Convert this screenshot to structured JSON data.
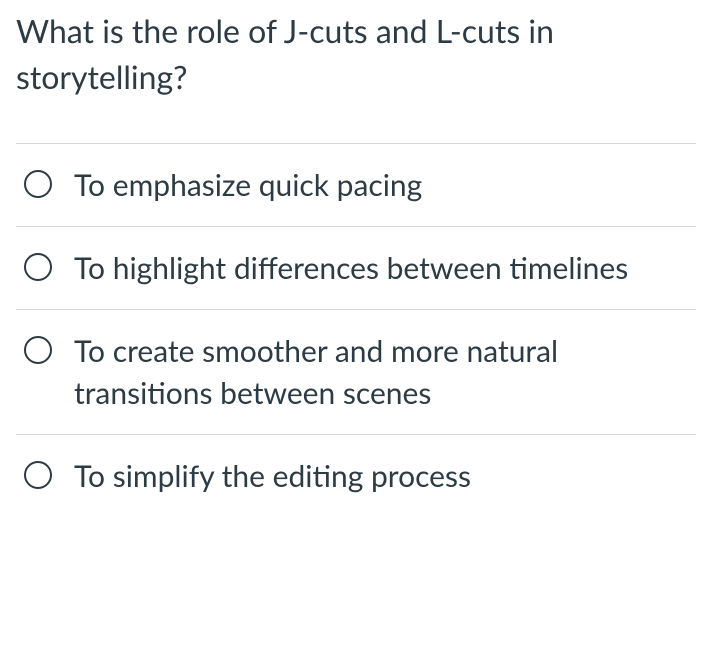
{
  "question": {
    "text": "What is the role of J-cuts and L-cuts in storytelling?"
  },
  "options": [
    {
      "label": "To emphasize quick pacing"
    },
    {
      "label": "To highlight differences between timelines"
    },
    {
      "label": "To create smoother and more natural transitions between scenes"
    },
    {
      "label": "To simplify the editing process"
    }
  ]
}
